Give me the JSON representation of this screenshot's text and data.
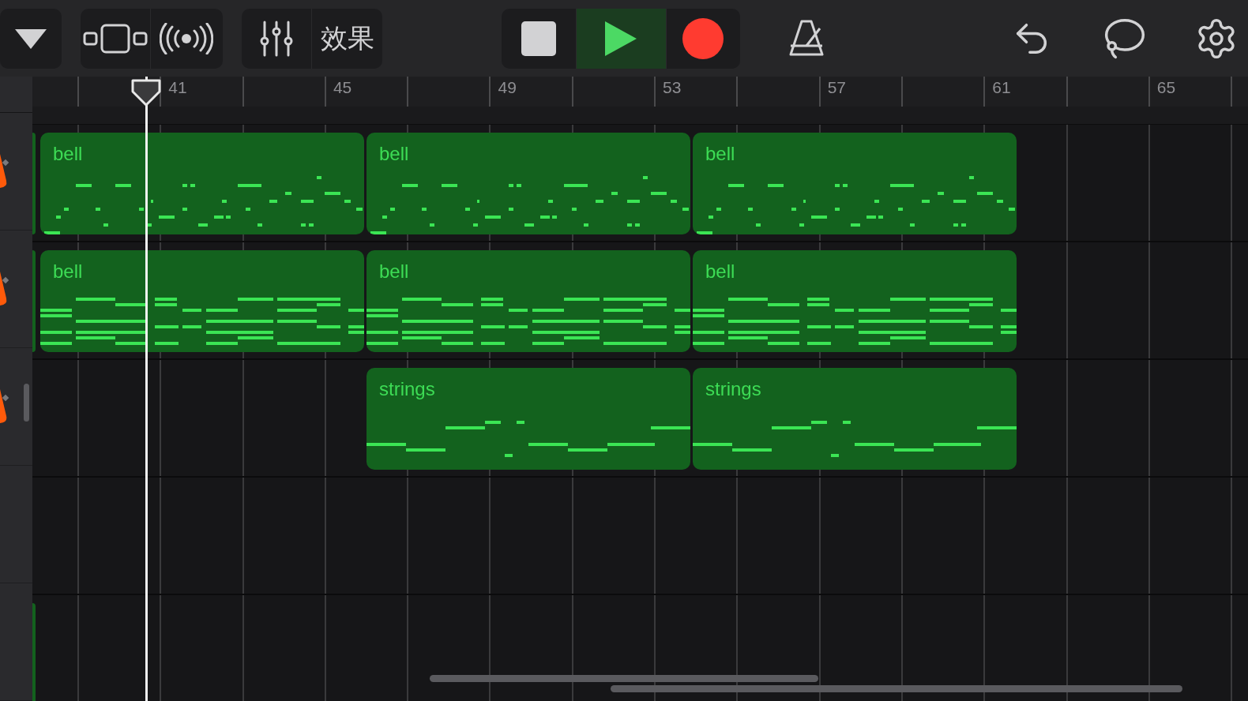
{
  "toolbar": {
    "effects_label": "效果",
    "transport": [
      {
        "kind": "stop",
        "selected": false
      },
      {
        "kind": "play",
        "selected": true
      },
      {
        "kind": "record",
        "selected": false
      }
    ]
  },
  "ruler": {
    "labels": [
      "41",
      "45",
      "49",
      "53",
      "57",
      "61",
      "65"
    ]
  },
  "tracks": [
    {
      "partial_clip": true,
      "regions": [
        {
          "name": "bell",
          "kind": "sparse"
        },
        {
          "name": "bell",
          "kind": "sparse"
        },
        {
          "name": "bell",
          "kind": "sparse"
        }
      ]
    },
    {
      "partial_clip": true,
      "regions": [
        {
          "name": "bell",
          "kind": "dense"
        },
        {
          "name": "bell",
          "kind": "dense"
        },
        {
          "name": "bell",
          "kind": "dense"
        }
      ]
    },
    {
      "partial_clip": false,
      "regions": [
        {
          "name": "strings",
          "kind": "lines"
        },
        {
          "name": "strings",
          "kind": "lines"
        }
      ]
    },
    {
      "partial_clip": false
    },
    {
      "partial_clip": true
    }
  ]
}
